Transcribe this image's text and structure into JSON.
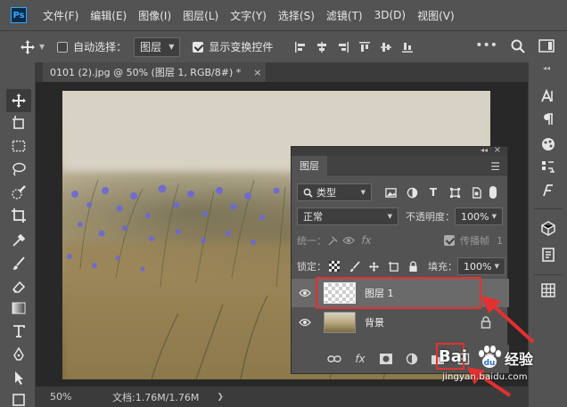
{
  "app": {
    "logo": "Ps",
    "menu": [
      "文件(F)",
      "编辑(E)",
      "图像(I)",
      "图层(L)",
      "文字(Y)",
      "选择(S)",
      "滤镜(T)",
      "3D(D)",
      "视图(V)"
    ]
  },
  "options_bar": {
    "auto_select_label": "自动选择：",
    "auto_select_checked": false,
    "auto_select_target": "图层",
    "show_transform_label": "显示变换控件",
    "show_transform_checked": true
  },
  "document": {
    "tab_title": "0101 (2).jpg @ 50% (图层 1, RGB/8#) *",
    "close_glyph": "×"
  },
  "status": {
    "zoom": "50%",
    "doc_size": "文档:1.76M/1.76M"
  },
  "layers_panel": {
    "tab_label": "图层",
    "filter_type": "类型",
    "blend_mode": "正常",
    "opacity_label": "不透明度：",
    "opacity_value": "100%",
    "unify_label": "统一：",
    "propagate_label": "传播帧",
    "propagate_value": "1",
    "lock_label": "锁定：",
    "fill_label": "填充：",
    "fill_value": "100%",
    "layers": [
      {
        "name": "图层 1",
        "selected": true,
        "locked": false
      },
      {
        "name": "背景",
        "selected": false,
        "locked": true
      }
    ]
  },
  "watermark": {
    "brand": "经验",
    "du": "Bai",
    "site": "jingyan.baidu.com"
  },
  "colors": {
    "ui_bg": "#535353",
    "canvas_bg": "#282828",
    "annotation": "#e53030",
    "accent": "#31a8ff"
  }
}
